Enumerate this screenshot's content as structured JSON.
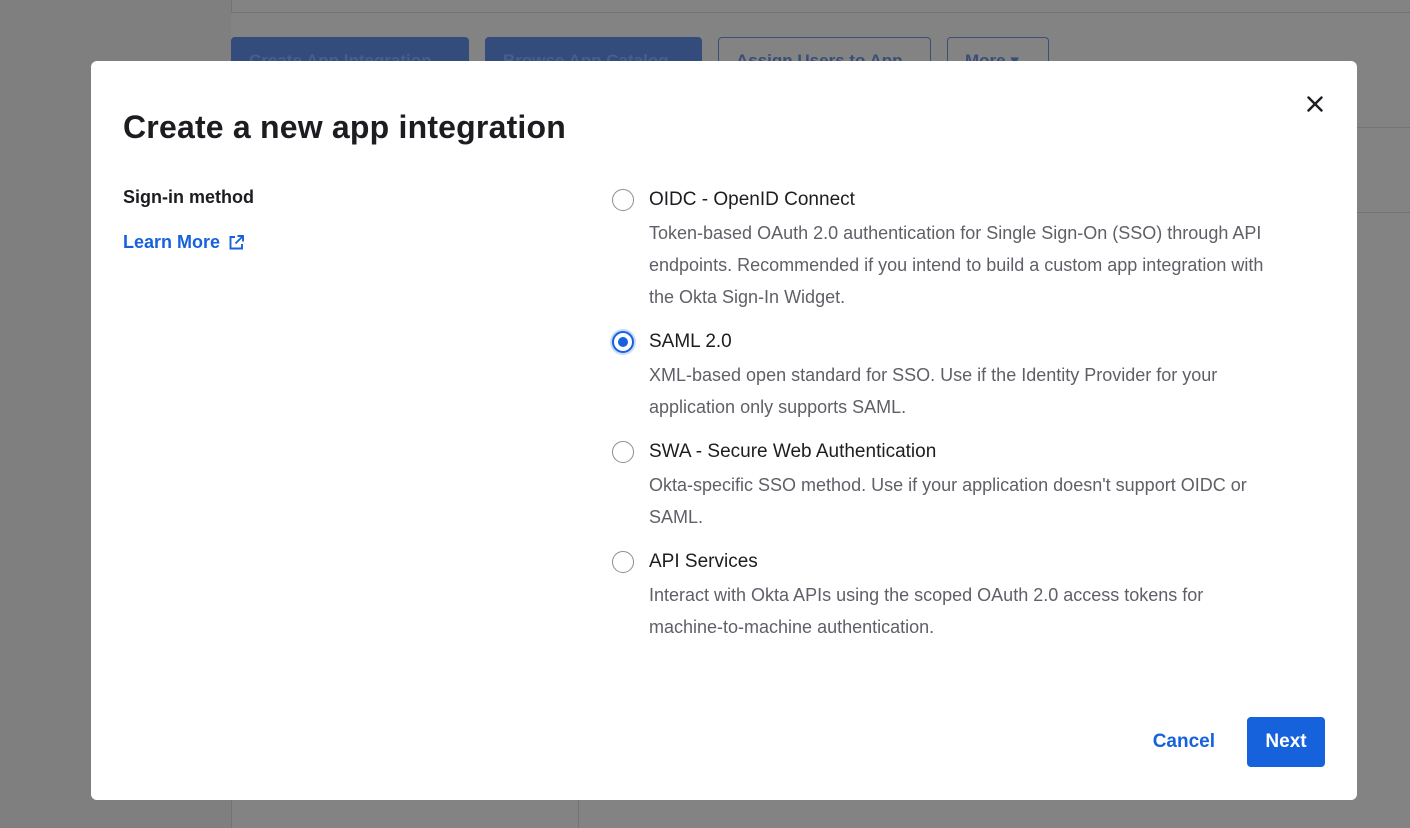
{
  "background": {
    "buttons": [
      {
        "label": "Create App Integration",
        "style": "primary"
      },
      {
        "label": "Browse App Catalog",
        "style": "primary"
      },
      {
        "label": "Assign Users to App",
        "style": "secondary"
      },
      {
        "label": "More ▾",
        "style": "secondary"
      }
    ]
  },
  "modal": {
    "title": "Create a new app integration",
    "close_icon": "close-icon",
    "section_label": "Sign-in method",
    "learn_more": {
      "label": "Learn More",
      "icon": "external-link-icon"
    },
    "options": [
      {
        "title": "OIDC - OpenID Connect",
        "lines": [
          "Token-based OAuth 2.0 authentication for Single Sign-On (SSO) through API",
          "endpoints. Recommended if you intend to build a custom app integration with",
          "the Okta Sign-In Widget."
        ],
        "selected": false
      },
      {
        "title": "SAML 2.0",
        "lines": [
          "XML-based open standard for SSO. Use if the Identity Provider for your",
          "application only supports SAML."
        ],
        "selected": true
      },
      {
        "title": "SWA - Secure Web Authentication",
        "lines": [
          "Okta-specific SSO method. Use if your application doesn't support OIDC or",
          "SAML."
        ],
        "selected": false
      },
      {
        "title": "API Services",
        "lines": [
          "Interact with Okta APIs using the scoped OAuth 2.0 access tokens for",
          "machine-to-machine authentication."
        ],
        "selected": false
      }
    ],
    "cancel_label": "Cancel",
    "next_label": "Next"
  },
  "colors": {
    "accent": "#1662dd",
    "overlay": "#808080",
    "text": "#1d1d21",
    "muted_text": "#5f5f68"
  }
}
